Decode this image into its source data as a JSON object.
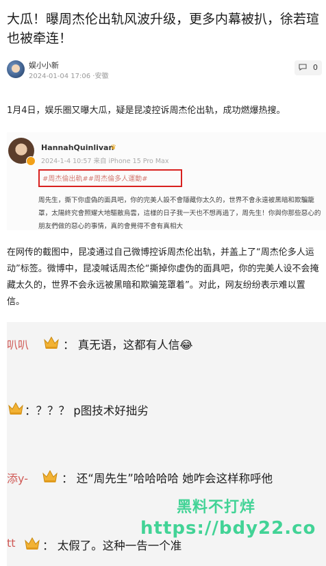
{
  "article": {
    "title": "大瓜！曝周杰伦出轨风波升级，更多内幕被扒，徐若瑄也被牵连！",
    "author_name": "娱小小新",
    "meta": "2024-01-04 17:06 ·安徽",
    "comment_count": "0",
    "para1": "1月4日，娱乐圈又曝大瓜，疑是昆凌控诉周杰伦出轨，成功燃爆热搜。",
    "para2": "在网传的截图中，昆凌通过自己微博控诉周杰伦出轨，并盖上了“周杰伦多人运动”标签。微博中，昆凌喊话周杰伦“撕掉你虚伪的面具吧，你的完美人设不会掩藏太久的，世界不会永远被黑暗和欺骗笼罩着”。对此，网友纷纷表示难以置信。"
  },
  "screenshot": {
    "username": "HannahQuinlivan",
    "time": "2024-1-4 10:57 来自 iPhone 15 Pro Max",
    "tags": "#周杰倫出軌##周杰倫多人運動#",
    "body": "周先生，撕下你虛偽的面具吧，你的完美人設不會隱藏你太久的，世界不會永遠被黑暗和欺騙籠罩，太陽終究會照耀大地驅散烏雲，這樣的日子我一天也不想再過了，周先生！你與你那些惡心的朋友們做的惡心的事情，真的會覺得不會有真相大"
  },
  "comments": [
    {
      "user": "叭叭",
      "text": "：  真无语，这都有人信😂"
    },
    {
      "user": "",
      "text": "：？？？ p图技术好拙劣"
    },
    {
      "user": "添y-",
      "text": "：  还“周先生”哈哈哈哈 她咋会这样称呼他"
    },
    {
      "user": "tt",
      "text": "：  太假了。这种一告一个准"
    }
  ],
  "watermark": {
    "line1": "黑料不打烊",
    "line2": "https://bdy22.co"
  },
  "colors": {
    "highlight_box": "#d8201e",
    "watermark": "#2fd08c",
    "comment_bg": "#f4f4f4"
  }
}
